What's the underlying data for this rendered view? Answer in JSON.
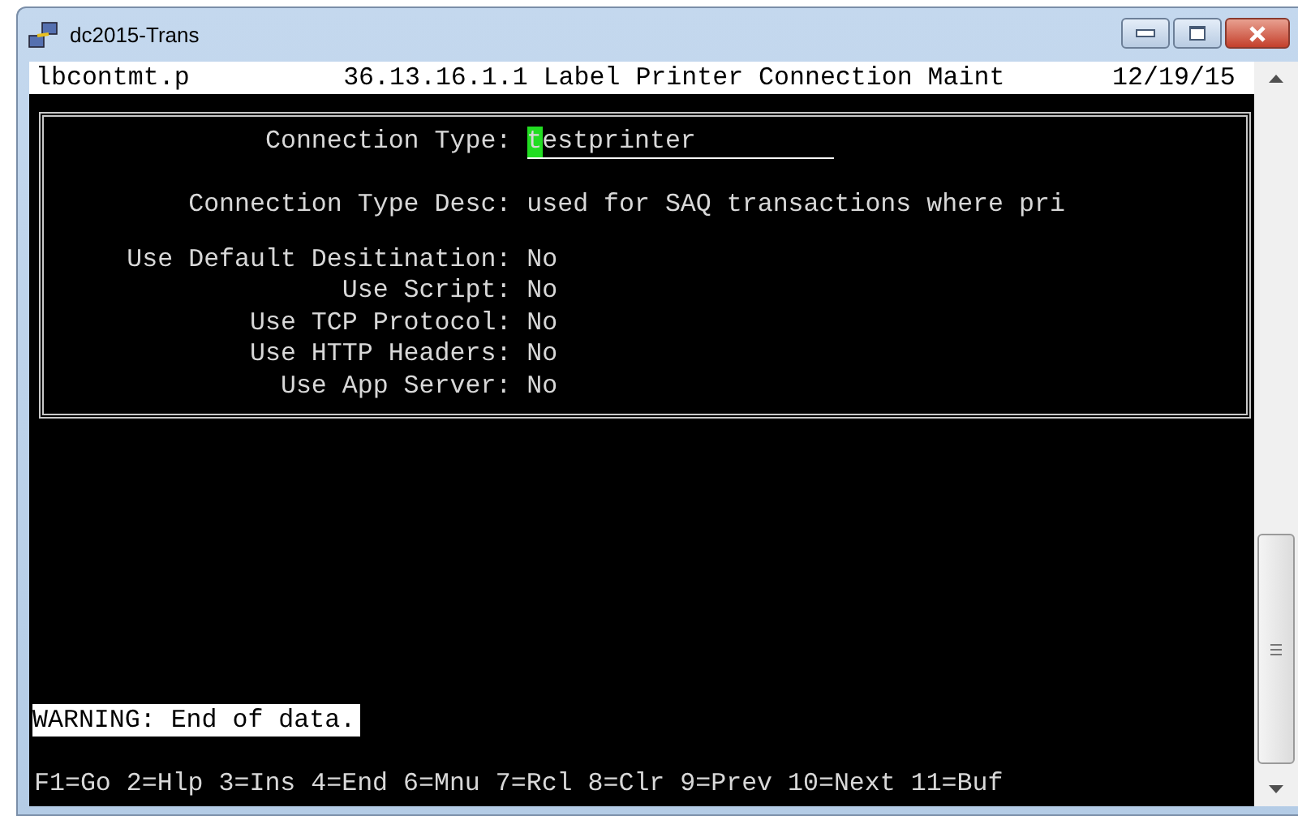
{
  "window": {
    "title": "dc2015-Trans"
  },
  "header": {
    "program": "lbcontmt.p",
    "title": "36.13.16.1.1 Label Printer Connection Maint",
    "date": "12/19/15"
  },
  "form": {
    "connection_type": {
      "label": "Connection Type:",
      "value": "testprinter",
      "focused": true
    },
    "description": {
      "label": "Connection Type Desc:",
      "value": "used for SAQ transactions where pri"
    },
    "fields": [
      {
        "label": "Use Default Desitination:",
        "value": "No"
      },
      {
        "label": "Use Script:",
        "value": "No"
      },
      {
        "label": "Use TCP Protocol:",
        "value": "No"
      },
      {
        "label": "Use HTTP Headers:",
        "value": "No"
      },
      {
        "label": "Use App Server:",
        "value": "No"
      }
    ]
  },
  "message": "WARNING: End of data.",
  "function_keys": "F1=Go 2=Hlp 3=Ins 4=End 6=Mnu 7=Rcl 8=Clr 9=Prev 10=Next 11=Buf"
}
